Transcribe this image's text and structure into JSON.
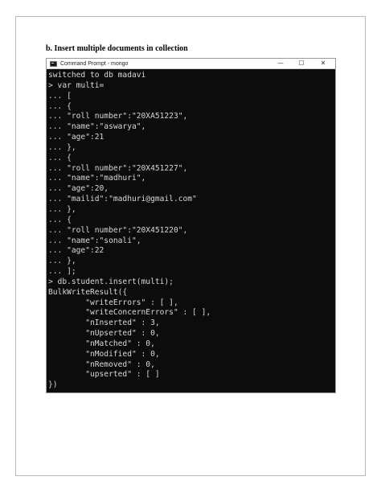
{
  "heading": "b. Insert multiple documents in collection",
  "window": {
    "title": "Command Prompt - mongo",
    "minimize_glyph": "—",
    "maximize_glyph": "☐",
    "close_glyph": "✕",
    "icon": "cmd-app-icon"
  },
  "terminal": {
    "lines": [
      "switched to db madavi",
      "> var multi=",
      "... [",
      "... {",
      "... \"roll number\":\"20XA51223\",",
      "... \"name\":\"aswarya\",",
      "... \"age\":21",
      "... },",
      "... {",
      "... \"roll number\":\"20X451227\",",
      "... \"name\":\"madhuri\",",
      "... \"age\":20,",
      "... \"mailid\":\"madhuri@gmail.com\"",
      "... },",
      "... {",
      "... \"roll number\":\"20X451220\",",
      "... \"name\":\"sonali\",",
      "... \"age\":22",
      "... },",
      "... ];",
      "> db.student.insert(multi);",
      "BulkWriteResult({",
      "        \"writeErrors\" : [ ],",
      "        \"writeConcernErrors\" : [ ],",
      "        \"nInserted\" : 3,",
      "        \"nUpserted\" : 0,",
      "        \"nMatched\" : 0,",
      "        \"nModified\" : 0,",
      "        \"nRemoved\" : 0,",
      "        \"upserted\" : [ ]",
      "})"
    ]
  },
  "colors": {
    "terminal_bg": "#0c0c0c",
    "terminal_fg": "#d8d8d8",
    "titlebar_bg": "#ffffff"
  }
}
